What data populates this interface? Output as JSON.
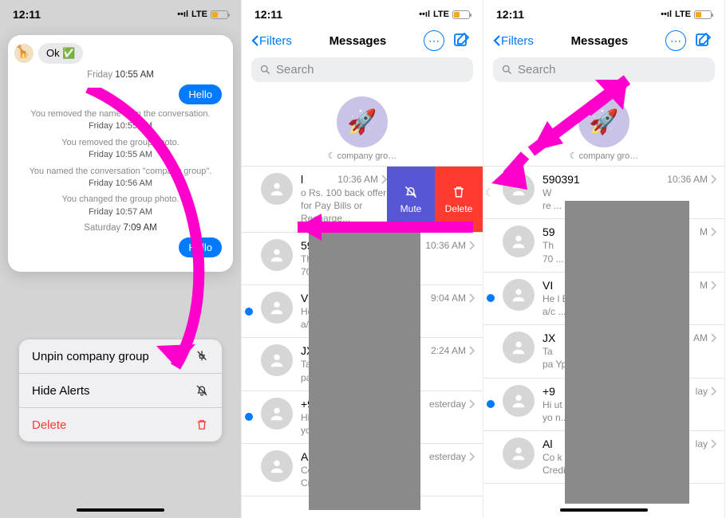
{
  "status": {
    "time": "12:11",
    "network": "LTE"
  },
  "screen1": {
    "msgIn": "Ok ✅",
    "ts1day": "Friday",
    "ts1time": "10:55 AM",
    "msgOut1": "Hello",
    "sys1": "You removed the name from the conversation.",
    "sys1ts": "Friday 10:55 AM",
    "sys2": "You removed the group photo.",
    "sys2ts": "Friday 10:55 AM",
    "sys3": "You named the conversation \"company group\".",
    "sys3ts": "Friday 10:56 AM",
    "sys4": "You changed the group photo.",
    "sys4ts": "Friday 10:57 AM",
    "ts2day": "Saturday",
    "ts2time": "7:09 AM",
    "msgOut2": "Hello",
    "action1": "Unpin company group",
    "action2": "Hide Alerts",
    "action3": "Delete"
  },
  "header": {
    "filters": "Filters",
    "title": "Messages",
    "searchPlaceholder": "Search"
  },
  "pinned": {
    "label": "company gro…"
  },
  "swipe": {
    "mute": "Mute",
    "delete": "Delete"
  },
  "s2rows": [
    {
      "title": "l",
      "time": "10:36 AM",
      "preview": "o Rs. 100 back offer\nfor Pay Bills or Recharge...",
      "unread": false
    },
    {
      "title": "590",
      "time": "10:36 AM",
      "preview": "The\n70 on Ama...",
      "unread": false
    },
    {
      "title": "VI",
      "time": "9:04 AM",
      "preview": "He r Axis Bank\na/c 6-07-20...",
      "unread": true
    },
    {
      "title": "JX",
      "time": "2:24 AM",
      "preview": "Ta m\npa F27CYpH...",
      "unread": false
    },
    {
      "title": "+9",
      "time": "esterday",
      "preview": "Hi but\nyo endation...",
      "unread": true
    },
    {
      "title": "Al",
      "time": "esterday",
      "preview": "Co is Bank\nCredit Card has been",
      "unread": false
    }
  ],
  "s3rows": [
    {
      "title": "590391",
      "time": "10:36 AM",
      "preview": "W\nre ...",
      "muted": true
    },
    {
      "title": "59",
      "time": "M",
      "preview": "Th\n70 ...",
      "unread": false
    },
    {
      "title": "VI",
      "time": "M",
      "preview": "He l Bank\na/c ...",
      "unread": true
    },
    {
      "title": "JX",
      "time": "AM",
      "preview": "Ta\npa YpH...",
      "unread": false
    },
    {
      "title": "+9",
      "time": "lay",
      "preview": "Hi ut\nyo n...",
      "unread": true
    },
    {
      "title": "Al",
      "time": "lay",
      "preview": "Co k\nCredit Card xxxx8863 has been",
      "unread": false
    }
  ]
}
